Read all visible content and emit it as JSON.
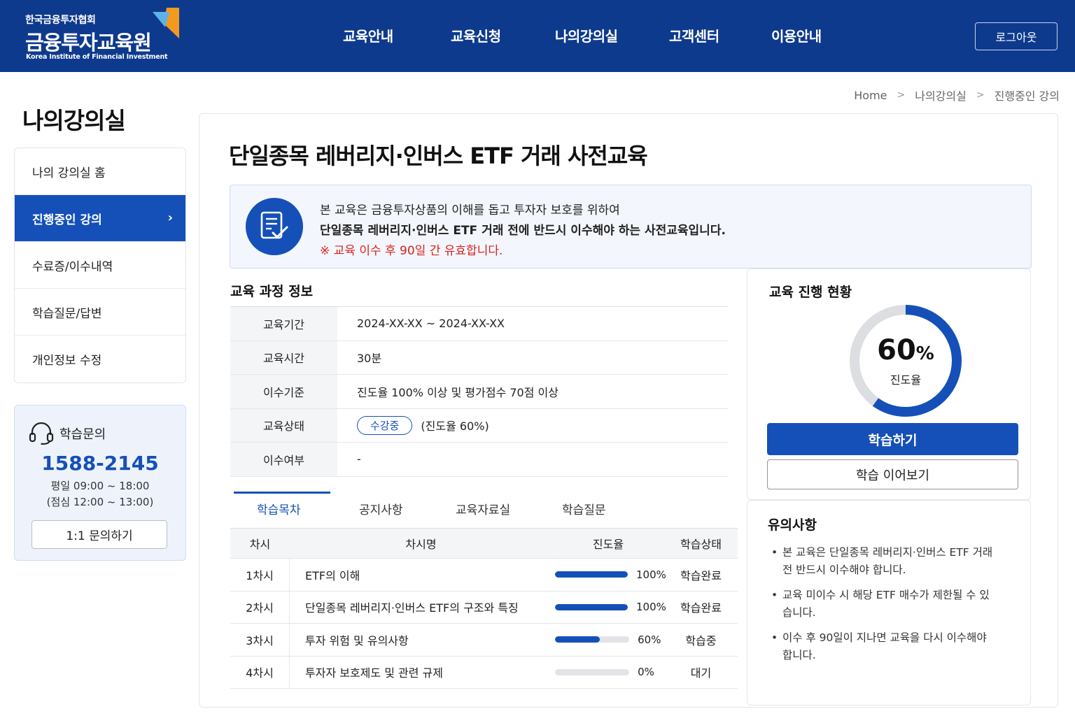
{
  "header": {
    "org_name": "한국금융투자협회",
    "site_name": "금융투자교육원",
    "site_name_en": "Korea Institute of Financial Investment",
    "nav": [
      "교육안내",
      "교육신청",
      "나의강의실",
      "고객센터",
      "이용안내"
    ],
    "logout_label": "로그아웃"
  },
  "breadcrumb": [
    "Home",
    "나의강의실",
    "진행중인 강의"
  ],
  "sidebar": {
    "title": "나의강의실",
    "items": [
      {
        "label": "나의 강의실 홈"
      },
      {
        "label": "진행중인 강의",
        "active": true
      },
      {
        "label": "수료증/이수내역"
      },
      {
        "label": "학습질문/답변"
      },
      {
        "label": "개인정보 수정"
      }
    ],
    "help": {
      "title": "학습문의",
      "phone": "1588-2145",
      "hours_weekday": "평일 09:00 ~ 18:00",
      "hours_lunch": "(점심 12:00 ~ 13:00)",
      "inquiry_button": "1:1 문의하기"
    }
  },
  "course": {
    "title": "단일종목 레버리지·인버스 ETF 거래 사전교육",
    "notice": {
      "line1": "본 교육은 금융투자상품의 이해를 돕고 투자자 보호를 위하여",
      "line2": "단일종목 레버리지·인버스 ETF 거래 전에 반드시 이수해야 하는 사전교육입니다.",
      "line3": "※ 교육 이수 후 90일 간 유효합니다."
    }
  },
  "info": {
    "section_title": "교육 과정 정보",
    "rows": [
      {
        "label": "교육기간",
        "value": "2024-XX-XX ~ 2024-XX-XX"
      },
      {
        "label": "교육시간",
        "value": "30분"
      },
      {
        "label": "이수기준",
        "value": "진도율 100% 이상 및 평가점수 70점 이상"
      },
      {
        "label": "교육상태",
        "value": "(진도율 60%)",
        "badge": "수강중"
      },
      {
        "label": "이수여부",
        "value": "-"
      }
    ]
  },
  "tabs": [
    "학습목차",
    "공지사항",
    "교육자료실",
    "학습질문"
  ],
  "lessons": {
    "headers": [
      "차시",
      "차시명",
      "진도율",
      "학습상태"
    ],
    "rows": [
      {
        "no": "1차시",
        "name": "ETF의 이해",
        "progress": 100,
        "progress_text": "100%",
        "status": "학습완료"
      },
      {
        "no": "2차시",
        "name": "단일종목 레버리지·인버스 ETF의 구조와 특징",
        "progress": 100,
        "progress_text": "100%",
        "status": "학습완료"
      },
      {
        "no": "3차시",
        "name": "투자 위험 및 유의사항",
        "progress": 60,
        "progress_text": "60%",
        "status": "학습중"
      },
      {
        "no": "4차시",
        "name": "투자자 보호제도 및 관련 규제",
        "progress": 0,
        "progress_text": "0%",
        "status": "대기"
      }
    ]
  },
  "progress": {
    "section_title": "교육 진행 현황",
    "value": 60,
    "value_text": "60",
    "unit": "%",
    "label": "진도율",
    "start_button": "학습하기",
    "continue_button": "학습 이어보기"
  },
  "cautions": {
    "title": "유의사항",
    "items": [
      "본 교육은 단일종목 레버리지·인버스 ETF 거래 전 반드시 이수해야 합니다.",
      "교육 미이수 시 해당 ETF 매수가 제한될 수 있습니다.",
      "이수 후 90일이 지나면 교육을 다시 이수해야 합니다."
    ]
  },
  "colors": {
    "header_bg": "#0e3a8e",
    "accent": "#1550b8",
    "logo_orange": "#f29a1f",
    "notice_red": "#d9231f"
  }
}
